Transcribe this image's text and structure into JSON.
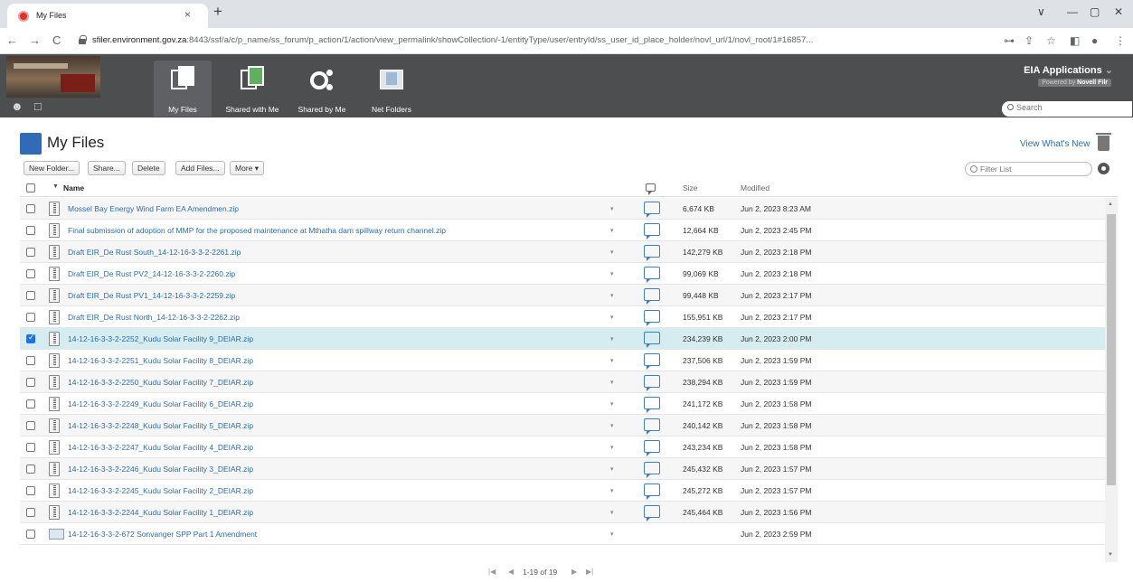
{
  "browser": {
    "tab_title": "My Files",
    "tab_close": "×",
    "new_tab": "+",
    "url_host": "sfiler.environment.gov.za",
    "url_rest": ":8443/ssf/a/c/p_name/ss_forum/p_action/1/action/view_permalink/showCollection/-1/entityType/user/entryId/ss_user_id_place_holder/novl_url/1/novl_root/1#16857...",
    "back": "←",
    "forward": "→",
    "reload": "C",
    "key_icon": "⊶",
    "share_icon": "⇪",
    "star_icon": "☆",
    "sidepanel_icon": "◧",
    "profile_icon": "●",
    "menu_icon": "⋮",
    "minimize": "—",
    "maximize": "▢",
    "close": "✕",
    "tab_list": "∨"
  },
  "header": {
    "nav": [
      {
        "label": "My Files",
        "icon": "my-files-icon",
        "active": true
      },
      {
        "label": "Shared with Me",
        "icon": "shared-with-me-icon",
        "active": false
      },
      {
        "label": "Shared by Me",
        "icon": "shared-by-me-icon",
        "active": false
      },
      {
        "label": "Net Folders",
        "icon": "net-folders-icon",
        "active": false
      }
    ],
    "brand": "EIA Applications",
    "brand_caret": "⌄",
    "powered_prefix": "Powered by ",
    "powered_name": "Novell Filr",
    "search_placeholder": "Search"
  },
  "page": {
    "title": "My Files",
    "whats_new": "View What's New"
  },
  "actions": {
    "new_folder": "New Folder...",
    "share": "Share...",
    "delete": "Delete",
    "add_files": "Add Files...",
    "more": "More ▾",
    "filter_placeholder": "Filter List"
  },
  "table": {
    "col_name": "Name",
    "col_size": "Size",
    "col_modified": "Modified",
    "sort_icon": "▼",
    "row_caret": "▾",
    "rows": [
      {
        "name": "Mossel Bay Energy Wind Farm EA Amendmen.zip",
        "size": "6,674 KB",
        "modified": "Jun 2, 2023 8:23 AM",
        "type": "zip",
        "checked": false
      },
      {
        "name": "Final submission of adoption of MMP for the proposed maintenance at Mthatha dam spillway return channel.zip",
        "size": "12,664 KB",
        "modified": "Jun 2, 2023 2:45 PM",
        "type": "zip",
        "checked": false
      },
      {
        "name": "Draft EIR_De Rust South_14-12-16-3-3-2-2261.zip",
        "size": "142,279 KB",
        "modified": "Jun 2, 2023 2:18 PM",
        "type": "zip",
        "checked": false
      },
      {
        "name": "Draft EIR_De Rust PV2_14-12-16-3-3-2-2260.zip",
        "size": "99,069 KB",
        "modified": "Jun 2, 2023 2:18 PM",
        "type": "zip",
        "checked": false
      },
      {
        "name": "Draft EIR_De Rust PV1_14-12-16-3-3-2-2259.zip",
        "size": "99,448 KB",
        "modified": "Jun 2, 2023 2:17 PM",
        "type": "zip",
        "checked": false
      },
      {
        "name": "Draft EIR_De Rust North_14-12-16-3-3-2-2262.zip",
        "size": "155,951 KB",
        "modified": "Jun 2, 2023 2:17 PM",
        "type": "zip",
        "checked": false
      },
      {
        "name": "14-12-16-3-3-2-2252_Kudu Solar Facility 9_DEIAR.zip",
        "size": "234,239 KB",
        "modified": "Jun 2, 2023 2:00 PM",
        "type": "zip",
        "checked": true
      },
      {
        "name": "14-12-16-3-3-2-2251_Kudu Solar Facility 8_DEIAR.zip",
        "size": "237,506 KB",
        "modified": "Jun 2, 2023 1:59 PM",
        "type": "zip",
        "checked": false
      },
      {
        "name": "14-12-16-3-3-2-2250_Kudu Solar Facility 7_DEIAR.zip",
        "size": "238,294 KB",
        "modified": "Jun 2, 2023 1:59 PM",
        "type": "zip",
        "checked": false
      },
      {
        "name": "14-12-16-3-3-2-2249_Kudu Solar Facility 6_DEIAR.zip",
        "size": "241,172 KB",
        "modified": "Jun 2, 2023 1:58 PM",
        "type": "zip",
        "checked": false
      },
      {
        "name": "14-12-16-3-3-2-2248_Kudu Solar Facility 5_DEIAR.zip",
        "size": "240,142 KB",
        "modified": "Jun 2, 2023 1:58 PM",
        "type": "zip",
        "checked": false
      },
      {
        "name": "14-12-16-3-3-2-2247_Kudu Solar Facility 4_DEIAR.zip",
        "size": "243,234 KB",
        "modified": "Jun 2, 2023 1:58 PM",
        "type": "zip",
        "checked": false
      },
      {
        "name": "14-12-16-3-3-2-2246_Kudu Solar Facility 3_DEIAR.zip",
        "size": "245,432 KB",
        "modified": "Jun 2, 2023 1:57 PM",
        "type": "zip",
        "checked": false
      },
      {
        "name": "14-12-16-3-3-2-2245_Kudu Solar Facility 2_DEIAR.zip",
        "size": "245,272 KB",
        "modified": "Jun 2, 2023 1:57 PM",
        "type": "zip",
        "checked": false
      },
      {
        "name": "14-12-16-3-3-2-2244_Kudu Solar Facility 1_DEIAR.zip",
        "size": "245,464 KB",
        "modified": "Jun 2, 2023 1:56 PM",
        "type": "zip",
        "checked": false
      },
      {
        "name": "14-12-16-3-3-2-672 Sonvanger SPP Part 1 Amendment",
        "size": "",
        "modified": "Jun 2, 2023 2:59 PM",
        "type": "folder",
        "checked": false
      }
    ]
  },
  "pager": {
    "first": "|◀",
    "prev": "◀",
    "range": "1-19 of 19",
    "next": "▶",
    "last": "▶|"
  },
  "colors": {
    "header_bg": "#4d4e50",
    "link": "#2a6ead",
    "selected_row": "#d5ecf0",
    "accent": "#2f6cb5"
  }
}
